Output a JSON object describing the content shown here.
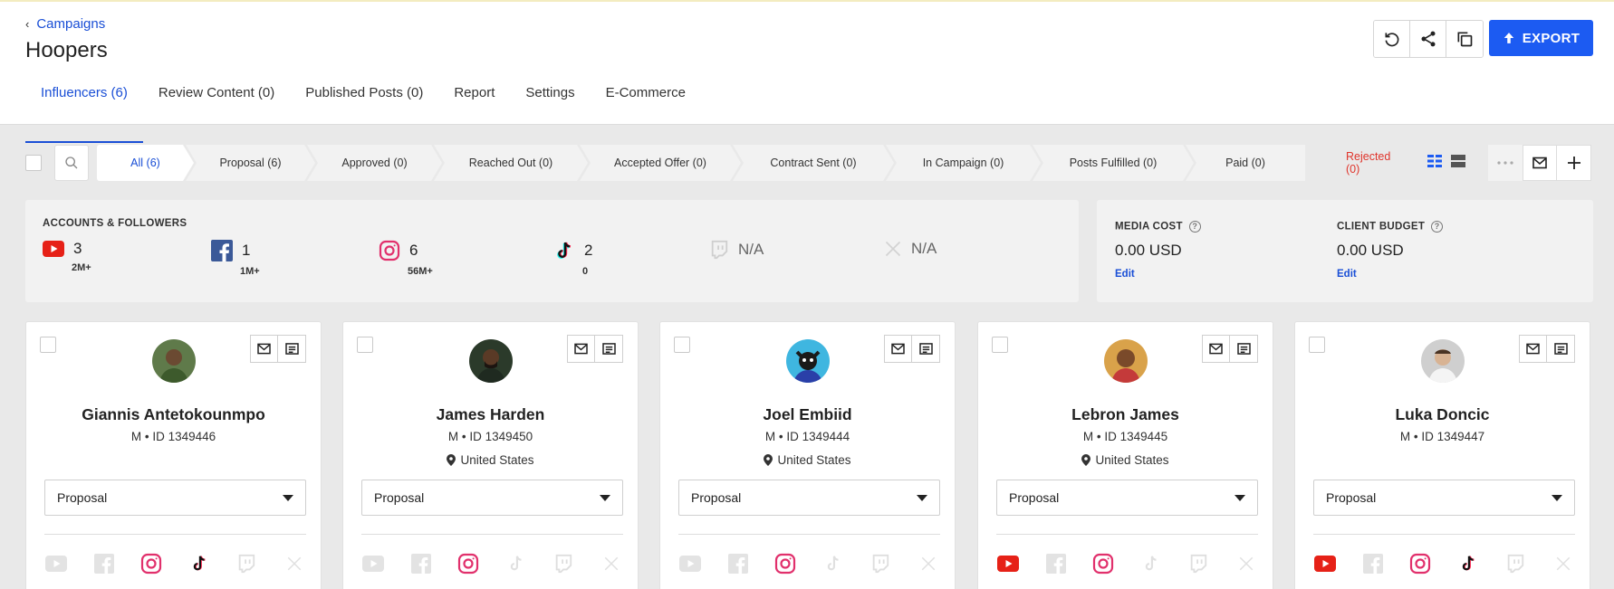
{
  "breadcrumb": {
    "label": "Campaigns"
  },
  "page": {
    "title": "Hoopers"
  },
  "header": {
    "export_label": "EXPORT"
  },
  "tabs": [
    {
      "label": "Influencers (6)",
      "active": true
    },
    {
      "label": "Review Content (0)"
    },
    {
      "label": "Published Posts (0)"
    },
    {
      "label": "Report"
    },
    {
      "label": "Settings"
    },
    {
      "label": "E-Commerce"
    }
  ],
  "stages": [
    {
      "label": "All (6)",
      "active": true
    },
    {
      "label": "Proposal (6)"
    },
    {
      "label": "Approved (0)"
    },
    {
      "label": "Reached Out (0)"
    },
    {
      "label": "Accepted Offer (0)"
    },
    {
      "label": "Contract Sent (0)"
    },
    {
      "label": "In Campaign (0)"
    },
    {
      "label": "Posts Fulfilled (0)"
    },
    {
      "label": "Paid (0)"
    },
    {
      "label": "Rejected (0)"
    }
  ],
  "accounts": {
    "title": "ACCOUNTS & FOLLOWERS",
    "items": [
      {
        "icon": "youtube-icon",
        "count": "3",
        "followers": "2M+"
      },
      {
        "icon": "facebook-icon",
        "count": "1",
        "followers": "1M+"
      },
      {
        "icon": "instagram-icon",
        "count": "6",
        "followers": "56M+"
      },
      {
        "icon": "tiktok-icon",
        "count": "2",
        "followers": "0"
      },
      {
        "icon": "twitch-icon",
        "count": "N/A"
      },
      {
        "icon": "x-icon",
        "count": "N/A"
      }
    ]
  },
  "budget": {
    "media_cost_label": "MEDIA COST",
    "media_cost_value": "0.00 USD",
    "client_budget_label": "CLIENT BUDGET",
    "client_budget_value": "0.00 USD",
    "edit_label": "Edit"
  },
  "influencers": [
    {
      "name": "Giannis Antetokounmpo",
      "meta": "M • ID 1349446",
      "location": "",
      "stage": "Proposal"
    },
    {
      "name": "James Harden",
      "meta": "M • ID 1349450",
      "location": "United States",
      "stage": "Proposal"
    },
    {
      "name": "Joel Embiid",
      "meta": "M • ID 1349444",
      "location": "United States",
      "stage": "Proposal"
    },
    {
      "name": "Lebron James",
      "meta": "M • ID 1349445",
      "location": "United States",
      "stage": "Proposal"
    },
    {
      "name": "Luka Doncic",
      "meta": "M • ID 1349447",
      "location": "",
      "stage": "Proposal"
    }
  ],
  "colors": {
    "accent": "#1c5bf2",
    "rejected": "#e0342b",
    "youtube": "#e62117",
    "facebook": "#3b5998",
    "instagram": "#e1306c"
  }
}
